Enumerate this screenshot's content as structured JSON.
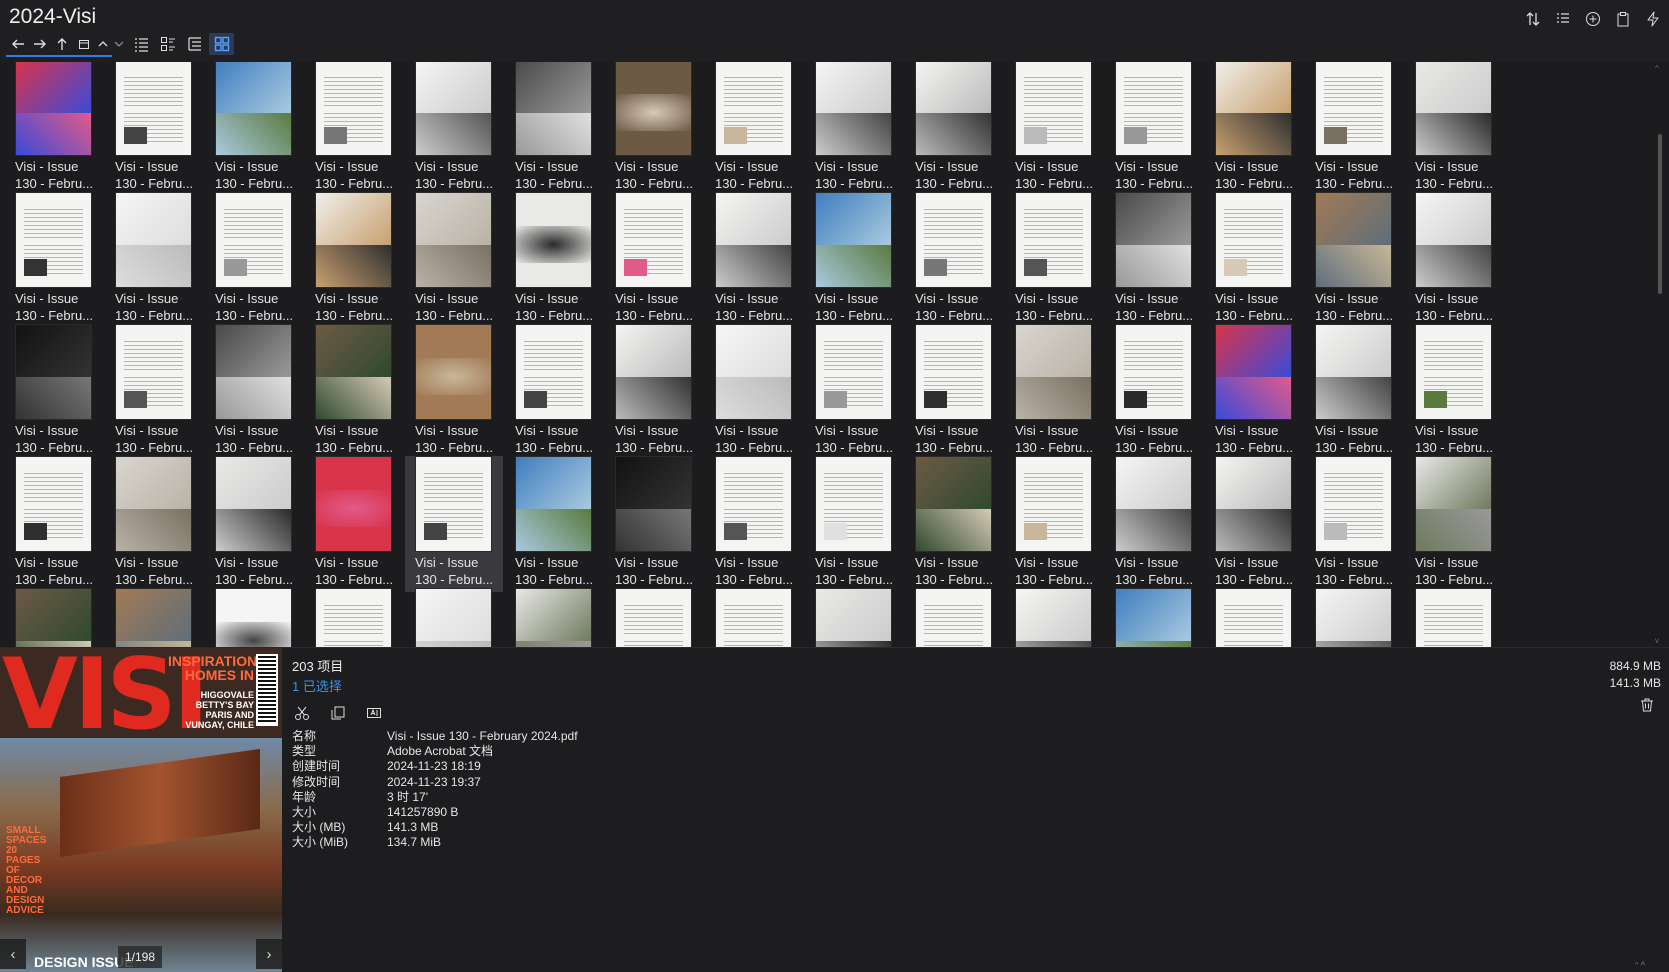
{
  "window": {
    "title": "2024-Visi"
  },
  "nav": {
    "back": "←",
    "forward": "→",
    "up": "↑",
    "history": "▭",
    "collapse": "^",
    "expand": "v",
    "views": [
      "details-view",
      "list-view",
      "tree-view",
      "thumbnail-view"
    ]
  },
  "toolbar": [
    "sort-icon",
    "options-list-icon",
    "new-icon",
    "paste-icon",
    "quick-action-icon"
  ],
  "file": {
    "label_line1": "Visi - Issue",
    "label_line2": "130 - Febru..."
  },
  "grid": {
    "rows_visible": 4,
    "cols": 15,
    "partial_row": true,
    "selected_index": 49
  },
  "preview": {
    "page_indicator": "1/198",
    "prev": "‹",
    "next": "›",
    "cover": {
      "logo": "VISI",
      "headline": "INSPIRATIONAL HOMES IN",
      "places": "HIGGOVALE BETTY'S BAY PARIS AND VUNGAY, CHILE",
      "small": "SMALL SPACES 20 PAGES OF DECOR AND DESIGN ADVICE",
      "bottom": "DESIGN ISSUE"
    }
  },
  "status": {
    "item_count": "203 项目",
    "selected": "1 已选择",
    "total_size": "884.9 MB",
    "selected_size": "141.3 MB"
  },
  "actions": [
    "cut-icon",
    "copy-icon",
    "rename-icon"
  ],
  "properties": [
    {
      "key": "名称",
      "value": "Visi - Issue 130 - February 2024.pdf"
    },
    {
      "key": "类型",
      "value": "Adobe Acrobat 文档"
    },
    {
      "key": "创建时间",
      "value": "2024-11-23   18:19"
    },
    {
      "key": "修改时间",
      "value": "2024-11-23   19:37"
    },
    {
      "key": "年龄",
      "value": "3 时 17'"
    },
    {
      "key": "大小",
      "value": "141257890 B"
    },
    {
      "key": "大小 (MB)",
      "value": "141.3 MB"
    },
    {
      "key": "大小 (MiB)",
      "value": "134.7 MiB"
    }
  ],
  "colors": {
    "background": "#1c1c1f",
    "accent": "#2f7de1",
    "selected_text": "#3b8fe8",
    "cover_red": "#e02a1f"
  }
}
